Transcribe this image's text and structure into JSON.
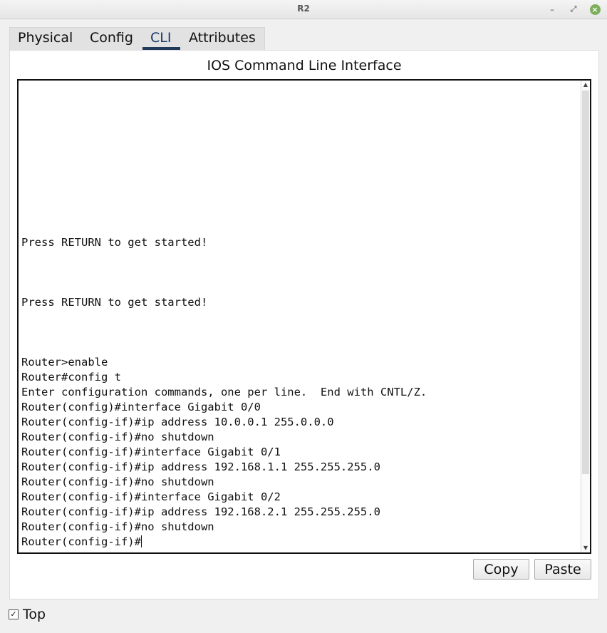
{
  "window": {
    "title": "R2",
    "minimize_glyph": "–",
    "maximize_glyph": "⤢",
    "close_glyph": "×"
  },
  "tabs": [
    {
      "label": "Physical"
    },
    {
      "label": "Config"
    },
    {
      "label": "CLI",
      "active": true
    },
    {
      "label": "Attributes"
    }
  ],
  "cli": {
    "heading": "IOS Command Line Interface",
    "lines": [
      "Press RETURN to get started!",
      "",
      "",
      "",
      "Press RETURN to get started!",
      "",
      "",
      "",
      "Router>enable",
      "Router#config t",
      "Enter configuration commands, one per line.  End with CNTL/Z.",
      "Router(config)#interface Gigabit 0/0",
      "Router(config-if)#ip address 10.0.0.1 255.0.0.0",
      "Router(config-if)#no shutdown",
      "Router(config-if)#interface Gigabit 0/1",
      "Router(config-if)#ip address 192.168.1.1 255.255.255.0",
      "Router(config-if)#no shutdown",
      "Router(config-if)#interface Gigabit 0/2",
      "Router(config-if)#ip address 192.168.2.1 255.255.255.0",
      "Router(config-if)#no shutdown"
    ],
    "prompt": "Router(config-if)#"
  },
  "buttons": {
    "copy": "Copy",
    "paste": "Paste"
  },
  "footer": {
    "top_checkbox_label": "Top",
    "top_checked": true
  },
  "colors": {
    "active_tab_underline": "#213a5c",
    "close_button": "#7dae5a"
  }
}
